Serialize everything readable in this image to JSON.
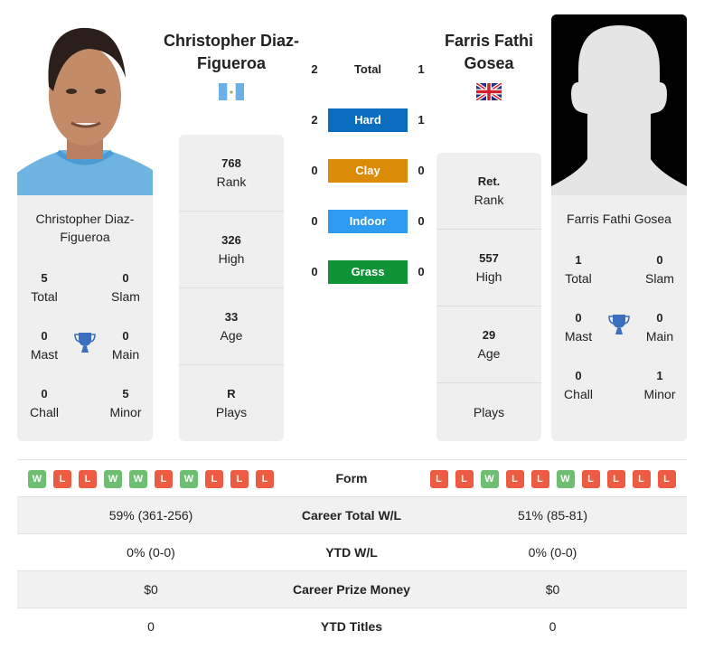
{
  "players": {
    "left": {
      "name": "Christopher Diaz-Figueroa",
      "name_line1": "Christopher Diaz-",
      "name_line2": "Figueroa",
      "flag": "guatemala-flag",
      "photo": "player-photo",
      "titles": {
        "total": {
          "value": "5",
          "label": "Total"
        },
        "slam": {
          "value": "0",
          "label": "Slam"
        },
        "mast": {
          "value": "0",
          "label": "Mast"
        },
        "main": {
          "value": "0",
          "label": "Main"
        },
        "chall": {
          "value": "0",
          "label": "Chall"
        },
        "minor": {
          "value": "5",
          "label": "Minor"
        }
      },
      "rank": {
        "value": "768",
        "label": "Rank"
      },
      "high": {
        "value": "326",
        "label": "High"
      },
      "age": {
        "value": "33",
        "label": "Age"
      },
      "plays": {
        "value": "R",
        "label": "Plays"
      }
    },
    "right": {
      "name": "Farris Fathi Gosea",
      "name_line1": "Farris Fathi",
      "name_line2": "Gosea",
      "flag": "united-kingdom-flag",
      "photo": "silhouette-placeholder",
      "titles": {
        "total": {
          "value": "1",
          "label": "Total"
        },
        "slam": {
          "value": "0",
          "label": "Slam"
        },
        "mast": {
          "value": "0",
          "label": "Mast"
        },
        "main": {
          "value": "0",
          "label": "Main"
        },
        "chall": {
          "value": "0",
          "label": "Chall"
        },
        "minor": {
          "value": "1",
          "label": "Minor"
        }
      },
      "rank": {
        "value": "Ret.",
        "label": "Rank"
      },
      "high": {
        "value": "557",
        "label": "High"
      },
      "age": {
        "value": "29",
        "label": "Age"
      },
      "plays": {
        "value": "",
        "label": "Plays"
      }
    }
  },
  "h2h": [
    {
      "label": "Total",
      "left": "2",
      "right": "1",
      "color": ""
    },
    {
      "label": "Hard",
      "left": "2",
      "right": "1",
      "color": "#0b6dbf"
    },
    {
      "label": "Clay",
      "left": "0",
      "right": "0",
      "color": "#dc8b06"
    },
    {
      "label": "Indoor",
      "left": "0",
      "right": "0",
      "color": "#2e9bf0"
    },
    {
      "label": "Grass",
      "left": "0",
      "right": "0",
      "color": "#0e9436"
    }
  ],
  "comparison": {
    "form": {
      "label": "Form",
      "left": [
        "W",
        "L",
        "L",
        "W",
        "W",
        "L",
        "W",
        "L",
        "L",
        "L"
      ],
      "right": [
        "L",
        "L",
        "W",
        "L",
        "L",
        "W",
        "L",
        "L",
        "L",
        "L"
      ]
    },
    "rows": [
      {
        "label": "Career Total W/L",
        "left": "59% (361-256)",
        "right": "51% (85-81)"
      },
      {
        "label": "YTD W/L",
        "left": "0% (0-0)",
        "right": "0% (0-0)"
      },
      {
        "label": "Career Prize Money",
        "left": "$0",
        "right": "$0"
      },
      {
        "label": "YTD Titles",
        "left": "0",
        "right": "0"
      }
    ]
  },
  "colors": {
    "win": "#6fbf73",
    "loss": "#ee5b43",
    "trophy": "#3a6fbf",
    "card_bg": "#efefef"
  }
}
